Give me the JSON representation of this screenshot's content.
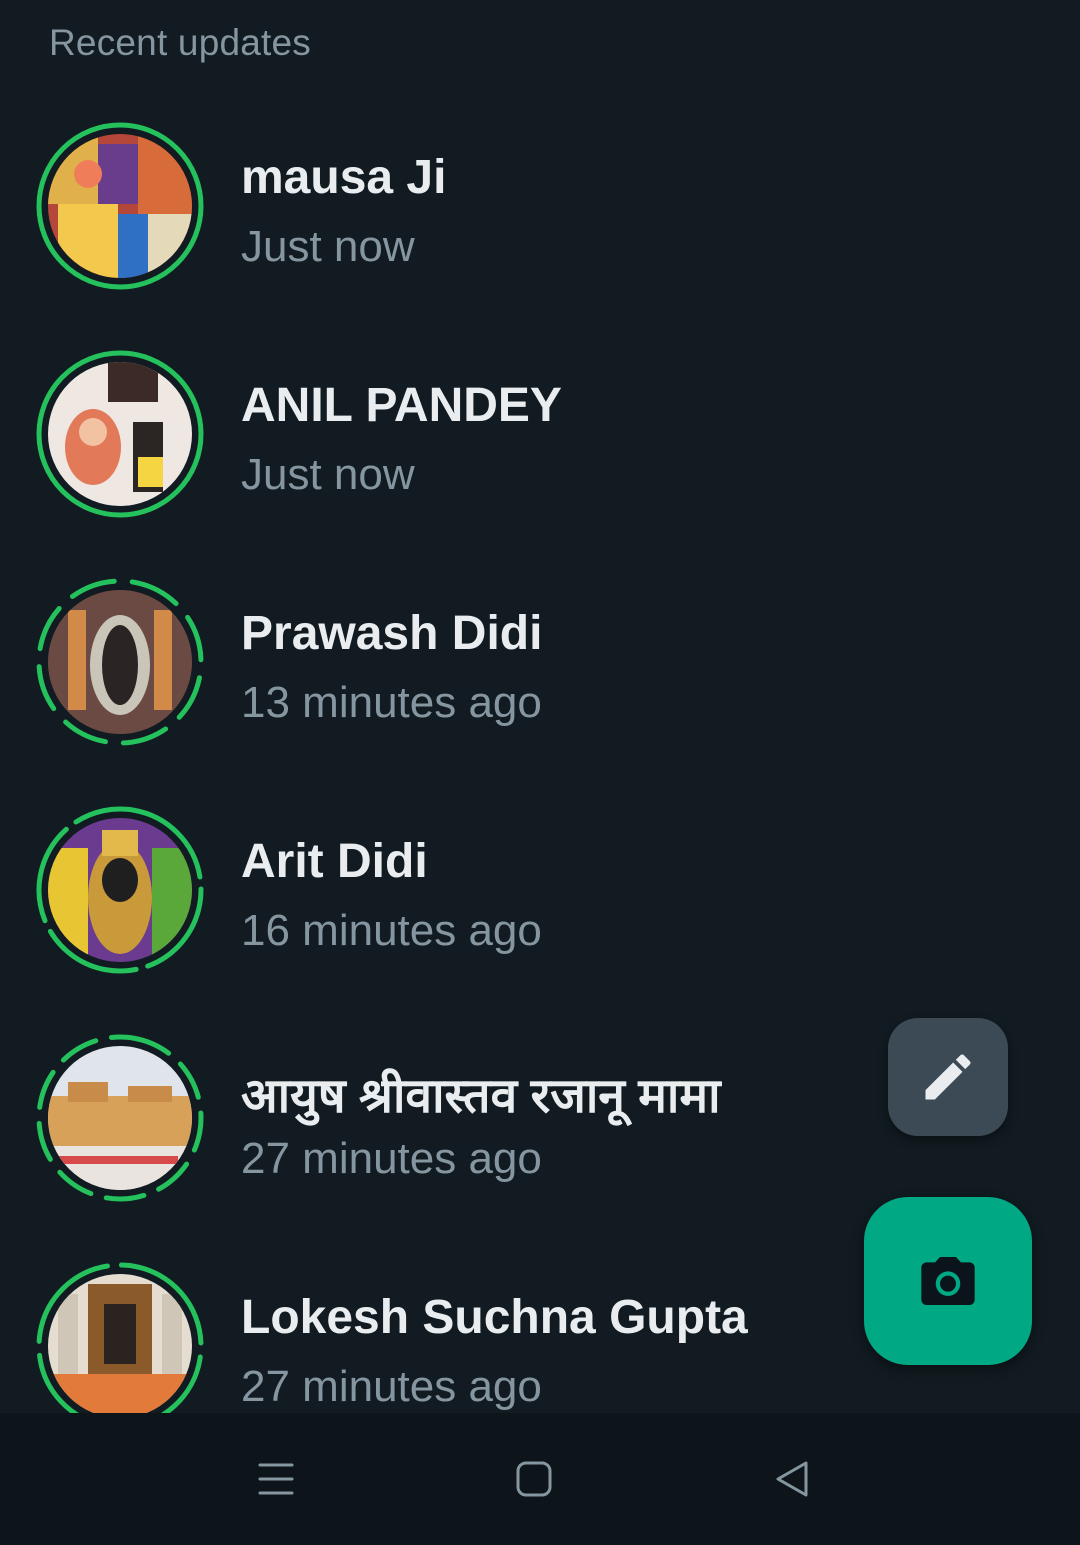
{
  "header": {
    "title": "Recent updates"
  },
  "statuses": [
    {
      "name": "mausa Ji",
      "time": "Just now",
      "ring": "solid"
    },
    {
      "name": "ANIL PANDEY",
      "time": "Just now",
      "ring": "solid"
    },
    {
      "name": "Prawash Didi",
      "time": "13 minutes ago",
      "ring": "segmented"
    },
    {
      "name": "Arit Didi",
      "time": "16 minutes ago",
      "ring": "segmented"
    },
    {
      "name": "आयुष श्रीवास्तव रजानू मामा",
      "time": "27 minutes ago",
      "ring": "segmented"
    },
    {
      "name": "Lokesh Suchna Gupta",
      "time": "27 minutes ago",
      "ring": "segmented"
    }
  ],
  "fab": {
    "edit_icon": "pencil-icon",
    "camera_icon": "camera-icon"
  },
  "nav": {
    "icons": [
      "menu-icon",
      "home-square-icon",
      "back-triangle-icon"
    ]
  },
  "colors": {
    "background": "#111b21",
    "accent": "#00a884",
    "ring": "#25c15d",
    "secondary_text": "#8696a0",
    "primary_text": "#e9edef",
    "edit_fab": "#3b4a54",
    "nav_bar": "#0d151a"
  }
}
